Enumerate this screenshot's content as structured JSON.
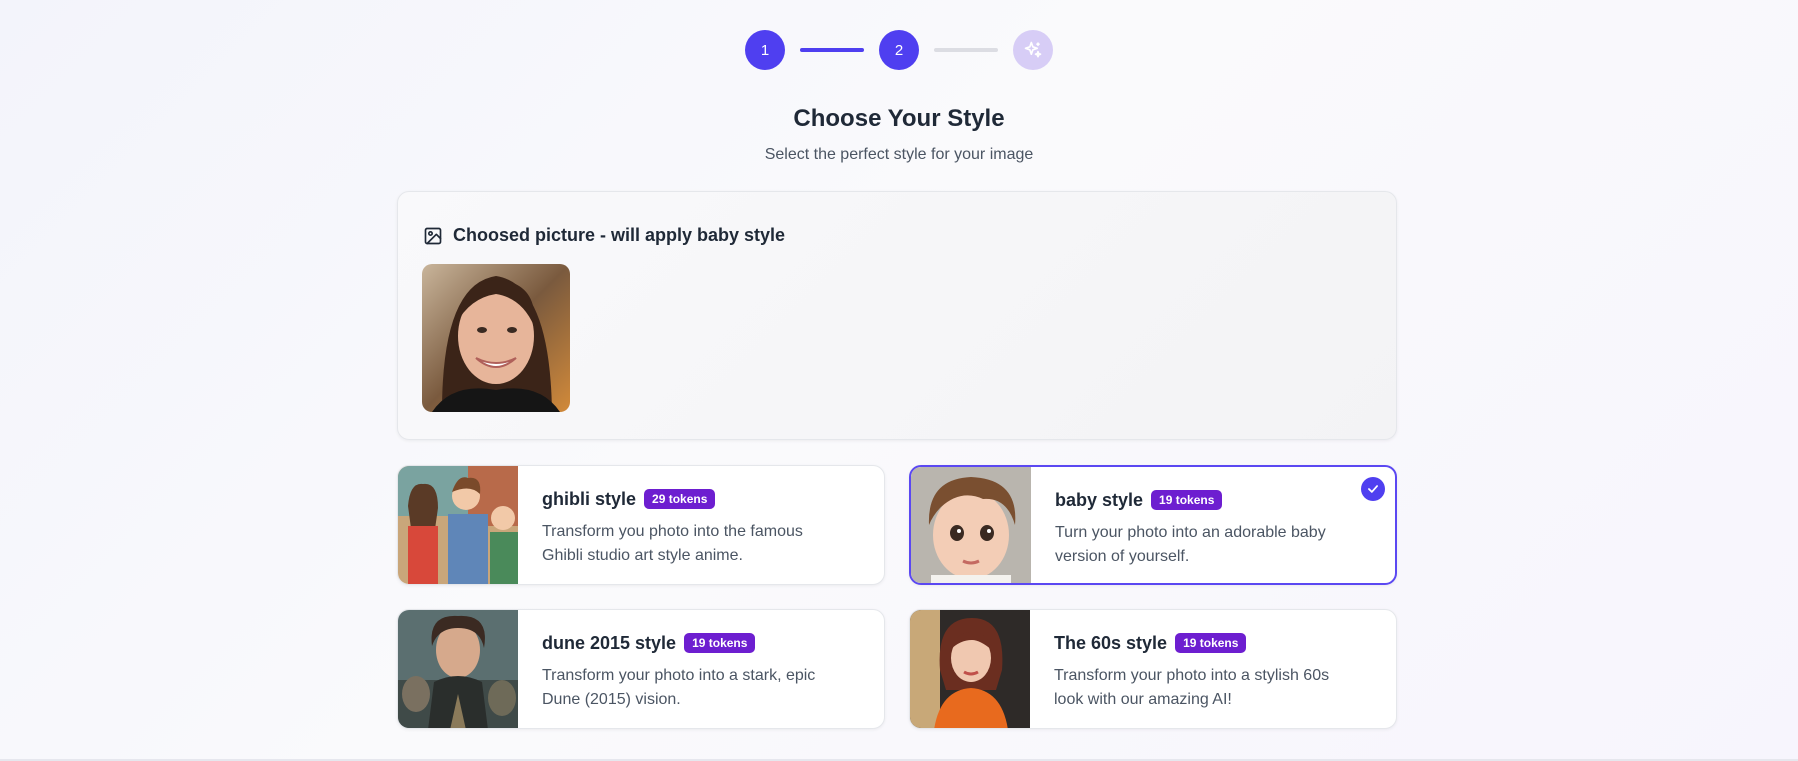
{
  "stepper": {
    "steps": [
      {
        "label": "1",
        "state": "done"
      },
      {
        "label": "2",
        "state": "current"
      },
      {
        "label": "",
        "icon": "sparkle-icon",
        "state": "pending"
      }
    ],
    "accent": "#4f3ff0"
  },
  "header": {
    "title": "Choose Your Style",
    "subtitle": "Select the perfect style for your image"
  },
  "chosen": {
    "label": "Choosed picture - will apply baby style",
    "icon": "image-icon"
  },
  "styles": [
    {
      "name": "ghibli style",
      "tokens": "29 tokens",
      "description": "Transform you photo into the famous Ghibli studio art style anime.",
      "selected": false
    },
    {
      "name": "baby style",
      "tokens": "19 tokens",
      "description": "Turn your photo into an adorable baby version of yourself.",
      "selected": true
    },
    {
      "name": "dune 2015 style",
      "tokens": "19 tokens",
      "description": "Transform your photo into a stark, epic Dune (2015) vision.",
      "selected": false
    },
    {
      "name": "The 60s style",
      "tokens": "19 tokens",
      "description": "Transform your photo into a stylish 60s look with our amazing AI!",
      "selected": false
    }
  ],
  "colors": {
    "badge": "#6d1ed0",
    "selected_border": "#5b48f2"
  }
}
